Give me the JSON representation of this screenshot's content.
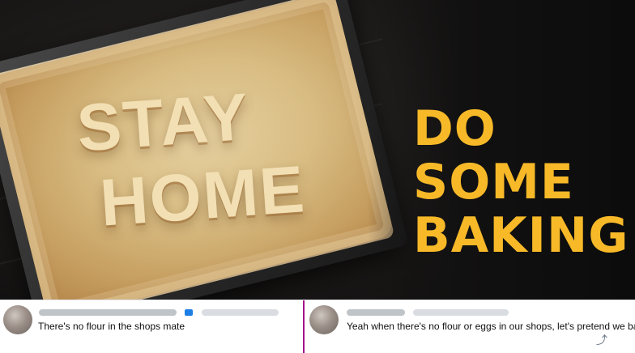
{
  "ad": {
    "headline_lines": [
      "DO SOME",
      "BAKING"
    ],
    "pie_text_lines": [
      "STAY",
      "HOME"
    ],
    "accent_color": "#f7b928"
  },
  "replies": [
    {
      "text": "There's no flour in the shops mate"
    },
    {
      "text": "Yeah when there's no flour or eggs in our shops, let's pretend we bake",
      "action_icon": "share-icon"
    }
  ],
  "colors": {
    "reply_divider": "#a3138a"
  }
}
